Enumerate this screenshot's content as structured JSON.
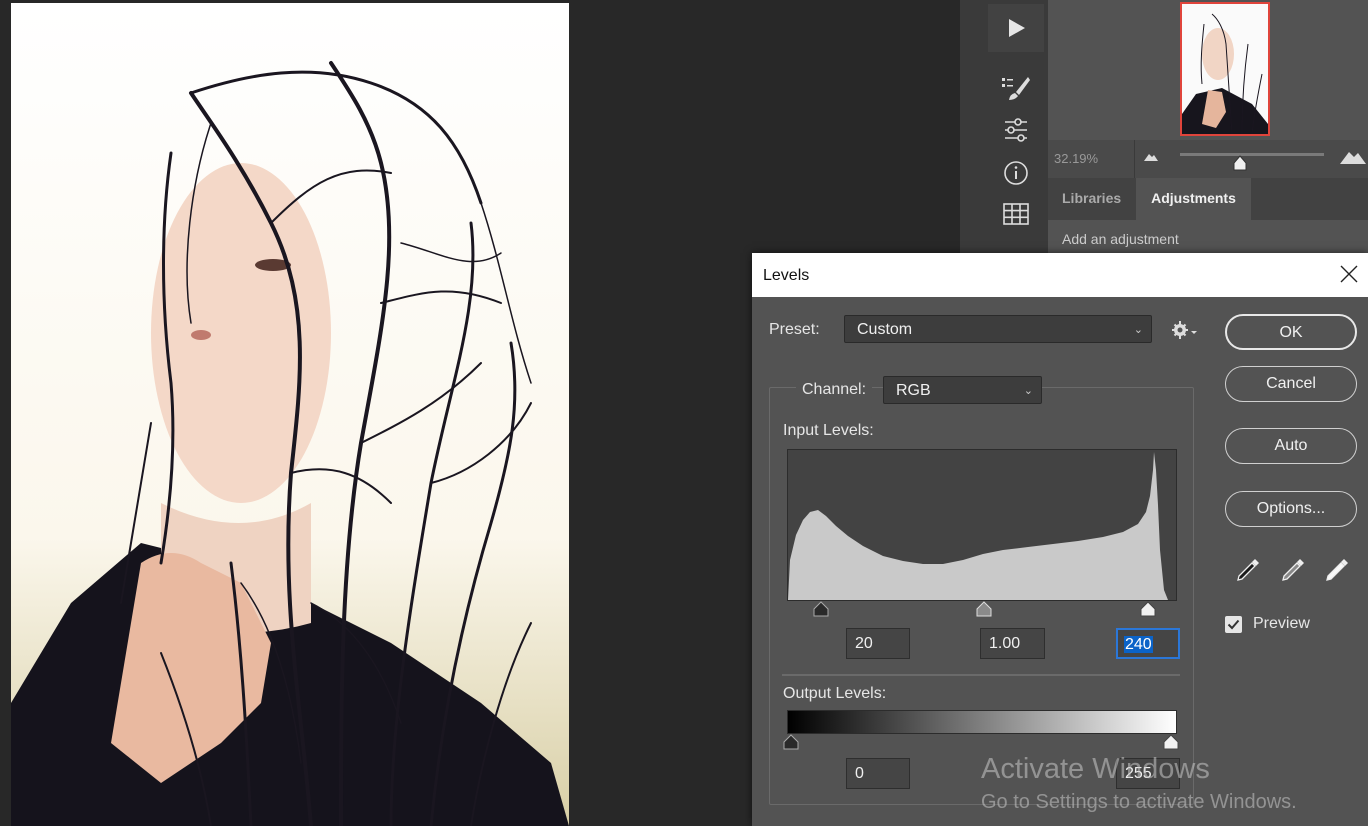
{
  "navigator": {
    "zoom": "32.19%",
    "zoom_slider_value": 0.42
  },
  "panel_tabs": {
    "libraries": "Libraries",
    "adjustments": "Adjustments"
  },
  "adjustments": {
    "hint": "Add an adjustment"
  },
  "levels": {
    "title": "Levels",
    "preset_label": "Preset:",
    "preset_value": "Custom",
    "channel_label": "Channel:",
    "channel_value": "RGB",
    "input_levels_label": "Input Levels:",
    "input_black": "20",
    "input_gamma": "1.00",
    "input_white": "240",
    "output_levels_label": "Output Levels:",
    "output_black": "0",
    "output_white": "255",
    "buttons": {
      "ok": "OK",
      "cancel": "Cancel",
      "auto": "Auto",
      "options": "Options..."
    },
    "preview_label": "Preview",
    "preview_checked": true
  },
  "watermark": {
    "line1": "Activate Windows",
    "line2": "Go to Settings to activate Windows."
  },
  "icons": [
    "play-icon",
    "brush-icon",
    "sliders-icon",
    "info-icon",
    "grid-icon",
    "gear-icon",
    "close-icon",
    "eyedropper-black-icon",
    "eyedropper-gray-icon",
    "eyedropper-white-icon",
    "mountain-small-icon",
    "mountain-large-icon"
  ],
  "colors": {
    "accent_blue": "#0b63c8",
    "thumb_border": "#e0443b",
    "panel_bg": "#535353"
  }
}
